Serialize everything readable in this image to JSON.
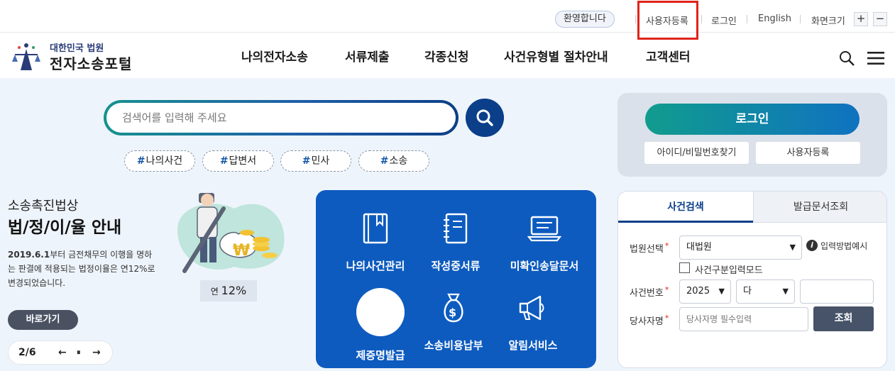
{
  "utility": {
    "welcome": "환영합니다",
    "register": "사용자등록",
    "login": "로그인",
    "english": "English",
    "zoom_label": "화면크기",
    "zoom_in": "+",
    "zoom_out": "−"
  },
  "header": {
    "logo_sub": "대한민국 법원",
    "logo_main": "전자소송포털",
    "nav": [
      "나의전자소송",
      "서류제출",
      "각종신청",
      "사건유형별 절차안내",
      "고객센터"
    ]
  },
  "search": {
    "placeholder": "검색어를 입력해 주세요",
    "tags": [
      "나의사건",
      "답변서",
      "민사",
      "소송"
    ],
    "hash": "#"
  },
  "banner": {
    "kicker": "소송촉진법상",
    "title": "법/정/이/율 안내",
    "desc_bold": "2019.6.1",
    "desc_rest": "부터 금전채무의 이행을 명하는 판결에 적용되는 법정이율은 연12%로 변경되었습니다.",
    "rate_prefix": "연",
    "rate_value": "12%",
    "button": "바로가기",
    "pager": "2/6",
    "prev": "←",
    "pause": "⏸",
    "next": "→"
  },
  "services": [
    {
      "label": "나의사건관리",
      "icon": "book-icon"
    },
    {
      "label": "작성중서류",
      "icon": "notebook-icon"
    },
    {
      "label": "미확인송달문서",
      "icon": "laptop-icon"
    },
    {
      "label": "제증명발급",
      "icon": "circle-icon"
    },
    {
      "label": "소송비용납부",
      "icon": "money-bag-icon"
    },
    {
      "label": "알림서비스",
      "icon": "megaphone-icon"
    }
  ],
  "login": {
    "button": "로그인",
    "find": "아이디/비밀번호찾기",
    "register": "사용자등록"
  },
  "case_search": {
    "tab_active": "사건검색",
    "tab_inactive": "발급문서조회",
    "court_label": "법원선택",
    "court_value": "대법원",
    "input_example": "입력방법예시",
    "mode_checkbox": "사건구분입력모드",
    "case_no_label": "사건번호",
    "year_value": "2025",
    "type_value": "다",
    "number_value": "",
    "party_label": "당사자명",
    "party_placeholder": "당사자명 필수입력",
    "submit": "조회",
    "required_mark": "*"
  },
  "colors": {
    "highlight": "#e0231c",
    "primary_blue": "#0d5bbf",
    "navy": "#0b3f8a",
    "teal": "#119c8e"
  }
}
